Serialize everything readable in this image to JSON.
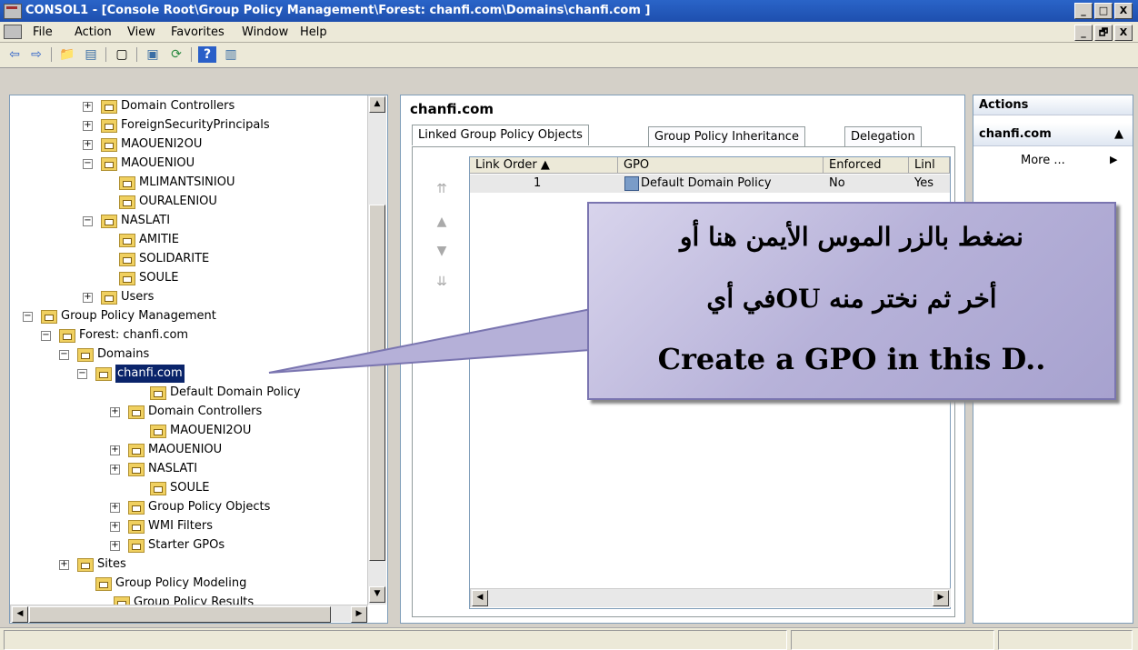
{
  "window": {
    "title": "CONSOL1 - [Console Root\\Group Policy Management\\Forest: chanfi.com\\Domains\\chanfi.com ]",
    "buttons": [
      "_",
      "□",
      "X"
    ],
    "mdi_buttons": [
      "_",
      "🗗",
      "X"
    ]
  },
  "menu": [
    "File",
    "Action",
    "View",
    "Favorites",
    "Window",
    "Help"
  ],
  "tree": {
    "rows": [
      {
        "label": "Domain Controllers",
        "expander": "+",
        "icon": "ou-folder-icon"
      },
      {
        "label": "ForeignSecurityPrincipals",
        "expander": "+",
        "icon": "folder-icon"
      },
      {
        "label": "MAOUENI2OU",
        "expander": "+",
        "icon": "ou-folder-icon"
      },
      {
        "label": "MAOUENIOU",
        "expander": "−",
        "icon": "ou-folder-icon"
      },
      {
        "label": "MLIMANTSINIOU",
        "expander": "",
        "icon": "ou-folder-icon"
      },
      {
        "label": "OURALENIOU",
        "expander": "",
        "icon": "ou-folder-icon"
      },
      {
        "label": "NASLATI",
        "expander": "−",
        "icon": "ou-folder-icon"
      },
      {
        "label": "AMITIE",
        "expander": "",
        "icon": "ou-folder-icon"
      },
      {
        "label": "SOLIDARITE",
        "expander": "",
        "icon": "ou-folder-icon"
      },
      {
        "label": "SOULE",
        "expander": "",
        "icon": "ou-folder-icon"
      },
      {
        "label": "Users",
        "expander": "+",
        "icon": "folder-icon"
      },
      {
        "label": "Group Policy Management",
        "expander": "−",
        "icon": "gpm-icon"
      },
      {
        "label": "Forest: chanfi.com",
        "expander": "−",
        "icon": "forest-icon"
      },
      {
        "label": "Domains",
        "expander": "−",
        "icon": "domains-icon"
      },
      {
        "label": "chanfi.com",
        "expander": "−",
        "icon": "domain-icon"
      },
      {
        "label": "Default Domain Policy",
        "expander": "",
        "icon": "gpo-link-icon"
      },
      {
        "label": "Domain Controllers",
        "expander": "+",
        "icon": "ou-folder-icon"
      },
      {
        "label": "MAOUENI2OU",
        "expander": "",
        "icon": "ou-folder-icon"
      },
      {
        "label": "MAOUENIOU",
        "expander": "+",
        "icon": "ou-folder-icon"
      },
      {
        "label": "NASLATI",
        "expander": "+",
        "icon": "ou-folder-icon"
      },
      {
        "label": "SOULE",
        "expander": "",
        "icon": "ou-folder-icon"
      },
      {
        "label": "Group Policy Objects",
        "expander": "+",
        "icon": "gpo-folder-icon"
      },
      {
        "label": "WMI Filters",
        "expander": "+",
        "icon": "wmi-filter-icon"
      },
      {
        "label": "Starter GPOs",
        "expander": "+",
        "icon": "starter-gpo-icon"
      },
      {
        "label": "Sites",
        "expander": "+",
        "icon": "sites-icon"
      },
      {
        "label": "Group Policy Modeling",
        "expander": "",
        "icon": "modeling-icon"
      },
      {
        "label": "Group Policy Results",
        "expander": "",
        "icon": "results-icon"
      }
    ]
  },
  "middle": {
    "heading": "chanfi.com",
    "tabs": [
      "Linked Group Policy Objects",
      "Group Policy Inheritance",
      "Delegation"
    ],
    "columns": [
      "Link Order",
      "GPO",
      "Enforced",
      "Link"
    ],
    "column_display": [
      "Link Order  ▲",
      "GPO",
      "Enforced",
      "Linl"
    ],
    "rows": [
      {
        "order": "1",
        "gpo": "Default Domain Policy",
        "enforced": "No",
        "link": "Yes"
      }
    ]
  },
  "actions": {
    "title": "Actions",
    "section": "chanfi.com",
    "items": [
      "More ..."
    ]
  },
  "callout": {
    "line1": "نضغط بالزر الموس الأيمن هنا أو",
    "line2": "أخر ثم نختر منه OUفي أي",
    "line3": "Create a GPO in this D.."
  }
}
